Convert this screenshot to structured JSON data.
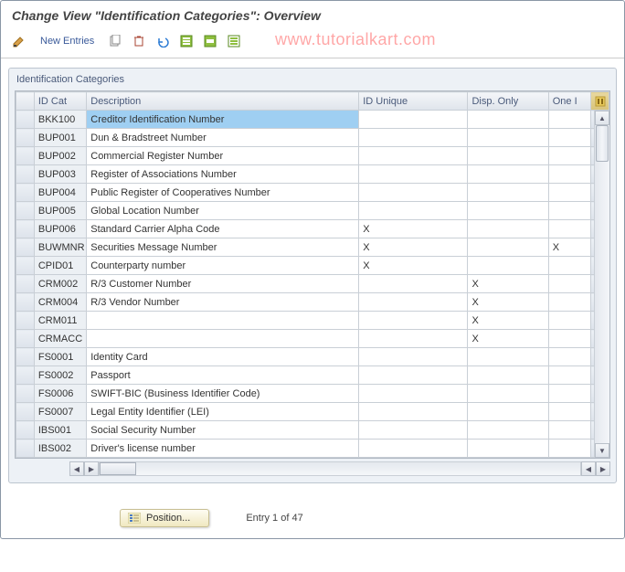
{
  "title": "Change View \"Identification Categories\": Overview",
  "watermark": "www.tutorialkart.com",
  "toolbar": {
    "new_entries": "New Entries"
  },
  "panel": {
    "title": "Identification Categories"
  },
  "columns": {
    "idcat": "ID Cat",
    "desc": "Description",
    "unique": "ID Unique",
    "disp": "Disp. Only",
    "one": "One I"
  },
  "rows": [
    {
      "id": "BKK100",
      "desc": "Creditor Identification Number",
      "unique": "",
      "disp": "",
      "one": "",
      "selected": true
    },
    {
      "id": "BUP001",
      "desc": "Dun & Bradstreet Number",
      "unique": "",
      "disp": "",
      "one": ""
    },
    {
      "id": "BUP002",
      "desc": "Commercial Register Number",
      "unique": "",
      "disp": "",
      "one": ""
    },
    {
      "id": "BUP003",
      "desc": "Register of Associations Number",
      "unique": "",
      "disp": "",
      "one": ""
    },
    {
      "id": "BUP004",
      "desc": "Public Register of Cooperatives Number",
      "unique": "",
      "disp": "",
      "one": ""
    },
    {
      "id": "BUP005",
      "desc": "Global Location Number",
      "unique": "",
      "disp": "",
      "one": ""
    },
    {
      "id": "BUP006",
      "desc": "Standard Carrier Alpha Code",
      "unique": "X",
      "disp": "",
      "one": ""
    },
    {
      "id": "BUWMNR",
      "desc": "Securities Message Number",
      "unique": "X",
      "disp": "",
      "one": "X"
    },
    {
      "id": "CPID01",
      "desc": "Counterparty number",
      "unique": "X",
      "disp": "",
      "one": ""
    },
    {
      "id": "CRM002",
      "desc": "R/3 Customer Number",
      "unique": "",
      "disp": "X",
      "one": ""
    },
    {
      "id": "CRM004",
      "desc": "R/3 Vendor Number",
      "unique": "",
      "disp": "X",
      "one": ""
    },
    {
      "id": "CRM011",
      "desc": "",
      "unique": "",
      "disp": "X",
      "one": ""
    },
    {
      "id": "CRMACC",
      "desc": "",
      "unique": "",
      "disp": "X",
      "one": ""
    },
    {
      "id": "FS0001",
      "desc": "Identity Card",
      "unique": "",
      "disp": "",
      "one": ""
    },
    {
      "id": "FS0002",
      "desc": "Passport",
      "unique": "",
      "disp": "",
      "one": ""
    },
    {
      "id": "FS0006",
      "desc": "SWIFT-BIC (Business Identifier Code)",
      "unique": "",
      "disp": "",
      "one": ""
    },
    {
      "id": "FS0007",
      "desc": "Legal Entity Identifier (LEI)",
      "unique": "",
      "disp": "",
      "one": ""
    },
    {
      "id": "IBS001",
      "desc": "Social Security Number",
      "unique": "",
      "disp": "",
      "one": ""
    },
    {
      "id": "IBS002",
      "desc": "Driver's license number",
      "unique": "",
      "disp": "",
      "one": ""
    }
  ],
  "footer": {
    "position": "Position...",
    "entry": "Entry 1 of 47"
  }
}
